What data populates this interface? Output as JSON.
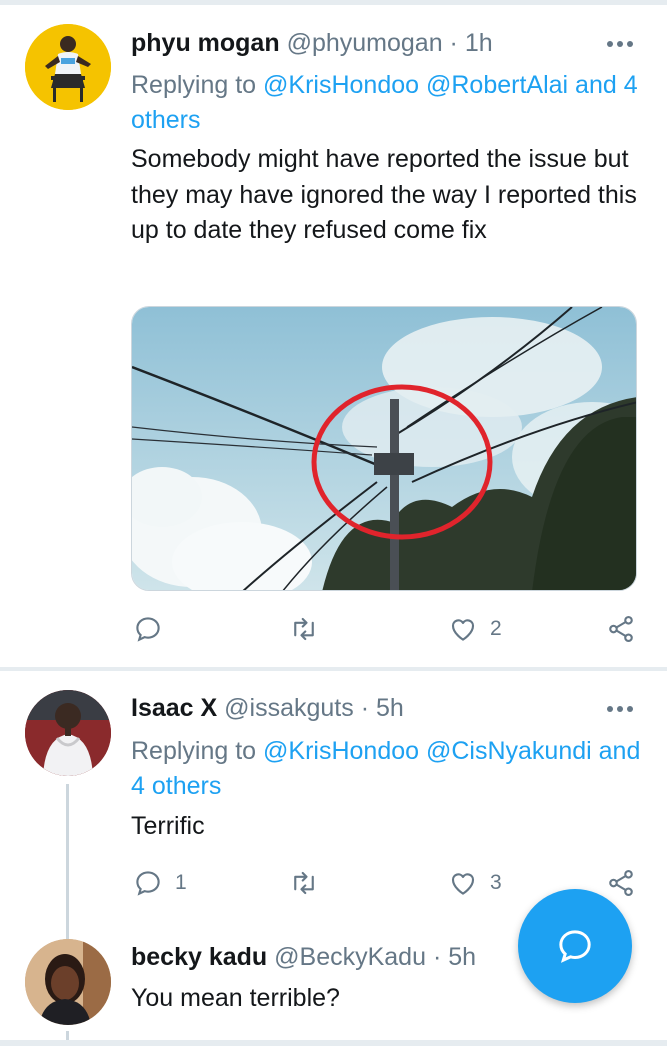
{
  "tweets": [
    {
      "name": "phyu mogan",
      "handle": "@phyumogan",
      "sep": "·",
      "time": "1h",
      "replying_prefix": "Replying to",
      "replying_users": "@KrisHondoo @RobertAlai",
      "replying_and": "and",
      "replying_others": "4 others",
      "text": "Somebody might have reported the issue but they may have ignored the way I reported this up to date they refused come fix",
      "counts": {
        "reply": "",
        "retweet": "",
        "like": "2"
      }
    },
    {
      "name": "Isaac X",
      "handle": "@issakguts",
      "sep": "·",
      "time": "5h",
      "replying_prefix": "Replying to",
      "replying_users": "@KrisHondoo @CisNyakundi",
      "replying_and": "and",
      "replying_others": "4 others",
      "text": "Terrific",
      "counts": {
        "reply": "1",
        "retweet": "",
        "like": "3"
      }
    },
    {
      "name": "becky kadu",
      "handle": "@BeckyKadu",
      "sep": "·",
      "time": "5h",
      "text": "You mean terrible?"
    }
  ],
  "icons": {
    "reply": "reply-icon",
    "retweet": "retweet-icon",
    "like": "heart-icon",
    "share": "share-icon",
    "more": "more-options-icon",
    "compose": "compose-reply-icon"
  },
  "colors": {
    "accent": "#1da1f2",
    "text": "#14171a",
    "muted": "#657786",
    "divider": "#e6ecf0"
  }
}
